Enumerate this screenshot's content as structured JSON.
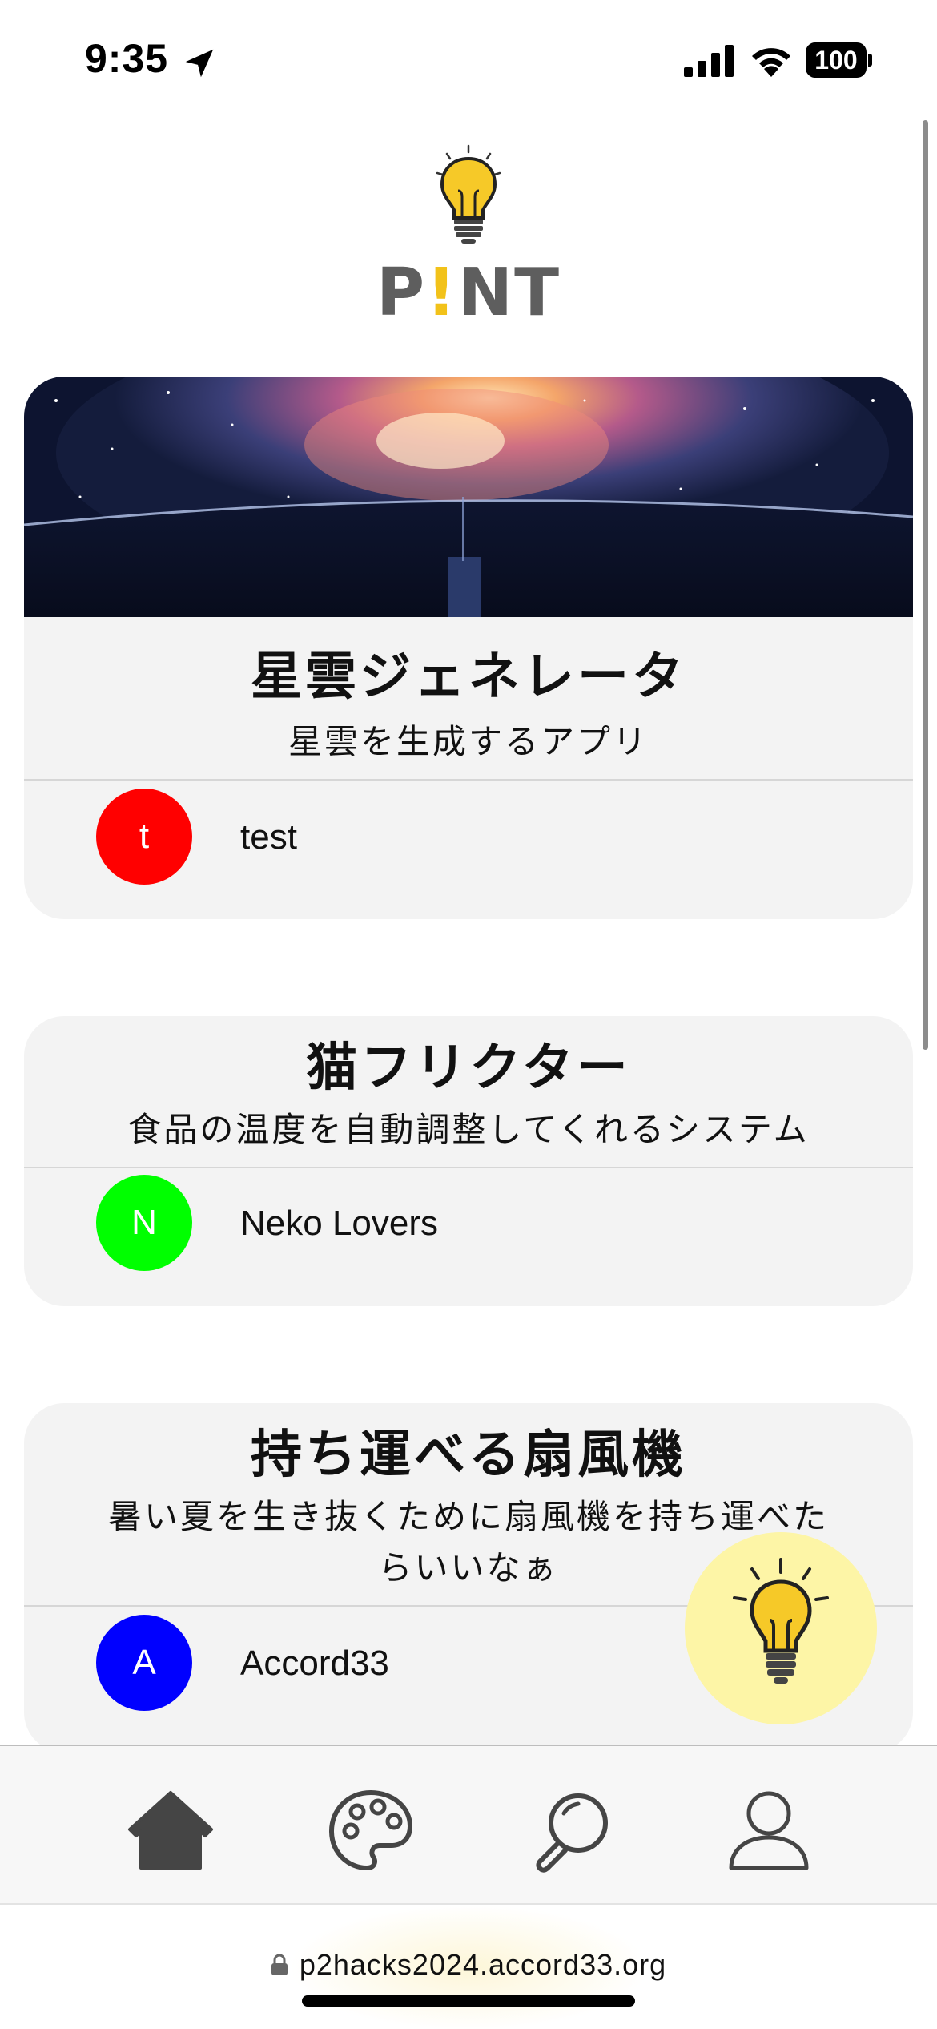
{
  "status_bar": {
    "time": "9:35",
    "battery": "100"
  },
  "logo": {
    "prefix": "P",
    "bang": "!",
    "suffix": "NT"
  },
  "cards": [
    {
      "title": "星雲ジェネレータ",
      "description": "星雲を生成するアプリ",
      "author_initial": "t",
      "author_name": "test",
      "avatar_color": "#ff0000"
    },
    {
      "title": "猫フリクター",
      "description": "食品の温度を自動調整してくれるシステム",
      "author_initial": "N",
      "author_name": "Neko Lovers",
      "avatar_color": "#00ff00"
    },
    {
      "title": "持ち運べる扇風機",
      "description": "暑い夏を生き抜くために扇風機を持ち運べたらいいなぁ",
      "author_initial": "A",
      "author_name": "Accord33",
      "avatar_color": "#0000ff"
    }
  ],
  "tabs": [
    {
      "icon": "home-icon",
      "active": true
    },
    {
      "icon": "palette-icon",
      "active": false
    },
    {
      "icon": "search-icon",
      "active": false
    },
    {
      "icon": "profile-icon",
      "active": false
    }
  ],
  "fab": {
    "icon": "lightbulb-icon",
    "color": "#fdf5a6"
  },
  "url_bar": {
    "url": "p2hacks2024.accord33.org"
  },
  "colors": {
    "accent_yellow": "#f2c21a",
    "card_bg": "#f3f3f3",
    "tab_icon": "#454545"
  }
}
